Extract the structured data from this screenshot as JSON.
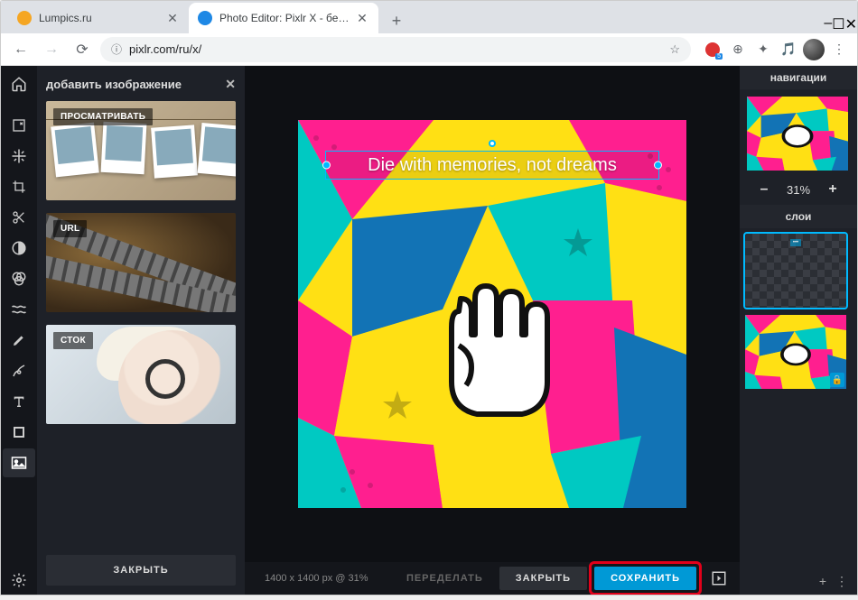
{
  "window": {
    "minimize": "–",
    "maximize": "☐",
    "close": "✕"
  },
  "tabs": [
    {
      "label": "Lumpics.ru",
      "favicon": "#f5a623"
    },
    {
      "label": "Photo Editor: Pixlr X - бесплатн…",
      "favicon": "#1e88e5"
    }
  ],
  "newtab": "+",
  "nav": {
    "back": "←",
    "forward": "→",
    "reload": "⟳"
  },
  "omnibox": {
    "lock": "ⓘ",
    "url": "pixlr.com/ru/x/",
    "star": "☆"
  },
  "ext_icons": [
    "⬤",
    "⊕",
    "★",
    "⋮",
    "≡"
  ],
  "toolbar_icons": [
    "home",
    "open",
    "move",
    "crop",
    "cut",
    "adjust",
    "filter",
    "liquify",
    "paint",
    "brush",
    "text",
    "fill",
    "image"
  ],
  "toolbar_bottom": "gear",
  "add_panel": {
    "title": "добавить изображение",
    "close": "✕",
    "sources": [
      {
        "key": "browse",
        "label": "ПРОСМАТРИВАТЬ"
      },
      {
        "key": "url",
        "label": "URL"
      },
      {
        "key": "stock",
        "label": "СТОК"
      }
    ],
    "close_btn": "ЗАКРЫТЬ"
  },
  "canvas": {
    "text": "Die with memories, not dreams"
  },
  "bottom": {
    "info": "1400 x 1400 px @ 31%",
    "redo": "ПЕРЕДЕЛАТЬ",
    "close": "ЗАКРЫТЬ",
    "save": "СОХРАНИТЬ",
    "next": "⍈"
  },
  "right": {
    "nav_title": "навигации",
    "zoom_minus": "–",
    "zoom_value": "31%",
    "zoom_plus": "+",
    "layers_title": "слои",
    "text_layer_preview": "••• ",
    "lock": "🔒",
    "add": "+",
    "more": "⋮"
  },
  "colors": {
    "accent": "#0099d6",
    "highlight": "#e2001a",
    "pop_pink": "#ff1f8f",
    "pop_yellow": "#ffe014",
    "pop_cyan": "#00c9c2",
    "pop_blue": "#1273b5"
  }
}
